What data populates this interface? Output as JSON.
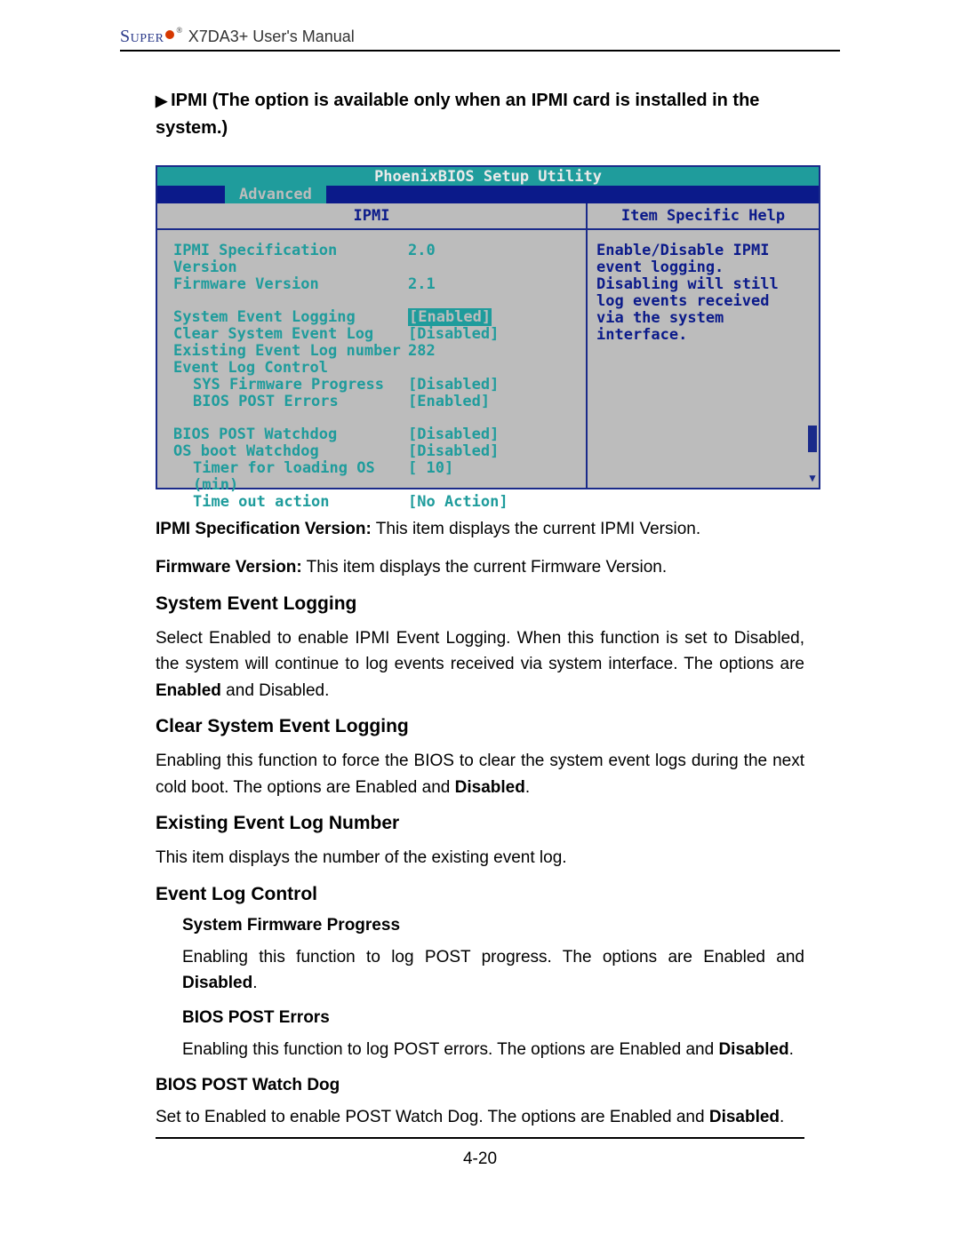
{
  "header": {
    "brand_text": "Super",
    "brand_o": "o",
    "manual_title": " X7DA3+ User's Manual"
  },
  "section_title_prefix": "IPMI",
  "section_title_rest": " (The option is available only when an IPMI card is installed in the system.)",
  "bios": {
    "title": "PhoenixBIOS Setup Utility",
    "tab": "Advanced",
    "col_left_header": "IPMI",
    "col_right_header": "Item Specific Help",
    "items": {
      "ipmi_spec_label": "IPMI Specification Version",
      "ipmi_spec_value": "2.0",
      "firmware_label": "Firmware Version",
      "firmware_value": "2.1",
      "sys_event_logging_label": "System Event Logging",
      "sys_event_logging_value": "[Enabled]",
      "clear_log_label": "Clear System Event Log",
      "clear_log_value": "[Disabled]",
      "existing_num_label": "Existing Event Log number",
      "existing_num_value": "282",
      "event_log_control_label": "Event Log Control",
      "sys_fw_progress_label": "SYS Firmware Progress",
      "sys_fw_progress_value": "[Disabled]",
      "bios_post_errors_label": "BIOS POST Errors",
      "bios_post_errors_value": "[Enabled]",
      "bios_post_wd_label": "BIOS POST Watchdog",
      "bios_post_wd_value": "[Disabled]",
      "os_boot_wd_label": "OS boot Watchdog",
      "os_boot_wd_value": "[Disabled]",
      "timer_label": "Timer for loading OS (min)",
      "timer_value": "[ 10]",
      "timeout_label": "Time out action",
      "timeout_value": "[No Action]"
    },
    "help_text": "Enable/Disable IPMI event logging. Disabling will still log events received via the system interface."
  },
  "body": {
    "p1_bold": "IPMI Specification Version:",
    "p1_rest": " This item displays the current IPMI Version.",
    "p2_bold": "Firmware Version:",
    "p2_rest": " This item displays the current Firmware Version.",
    "h_sys_event": "System Event Logging",
    "p_sys_event_a": "Select Enabled to enable IPMI Event Logging. When this function is set to Disabled, the system will continue to log events received via system interface. The options are ",
    "p_sys_event_b": "Enabled",
    "p_sys_event_c": " and Disabled.",
    "h_clear": "Clear System Event Logging",
    "p_clear_a": "Enabling this function to force the BIOS to clear the system event logs during the next cold boot. The options are Enabled and ",
    "p_clear_b": "Disabled",
    "p_clear_c": ".",
    "h_existing": "Existing Event Log Number",
    "p_existing": "This item displays the number of the existing event log.",
    "h_event_control": "Event Log Control",
    "h_sfp": "System Firmware Progress",
    "p_sfp_a": "Enabling this function to log POST progress. The options are Enabled and ",
    "p_sfp_b": "Disabled",
    "p_sfp_c": ".",
    "h_bpe": "BIOS POST Errors",
    "p_bpe_a": "Enabling this function to log POST errors. The options are Enabled and ",
    "p_bpe_b": "Disabled",
    "p_bpe_c": ".",
    "h_bpwd": "BIOS POST Watch Dog",
    "p_bpwd_a": "Set to Enabled to enable POST Watch Dog. The options are Enabled and ",
    "p_bpwd_b": "Disabled",
    "p_bpwd_c": "."
  },
  "page_number": "4-20"
}
